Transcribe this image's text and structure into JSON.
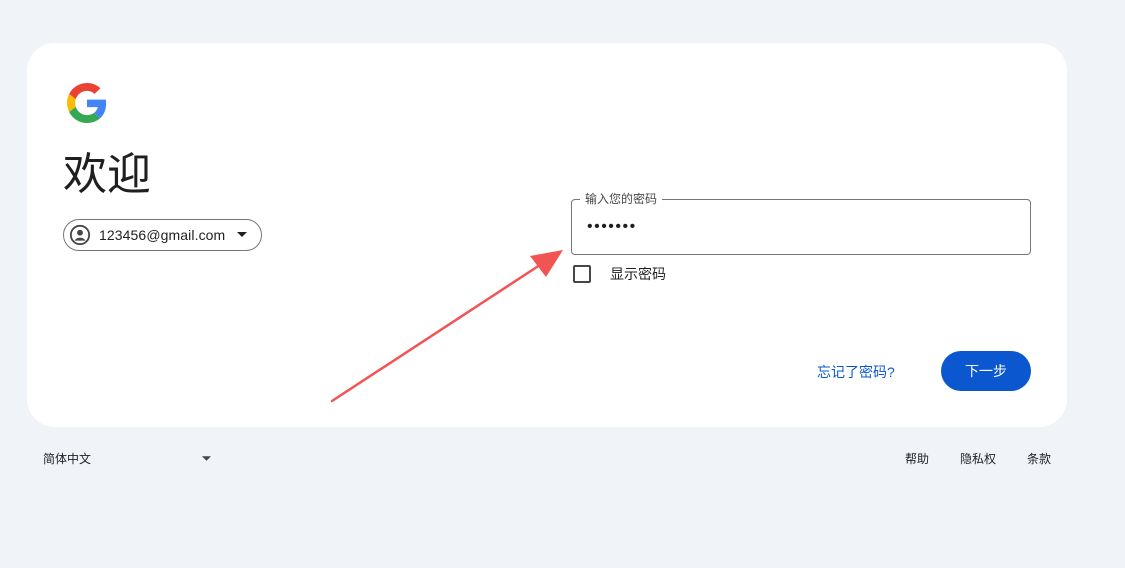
{
  "logo": {
    "icon": "google-g-logo-icon"
  },
  "heading": "欢迎",
  "account": {
    "email": "123456@gmail.com",
    "avatar_icon": "account-circle-icon",
    "caret_icon": "chevron-down-icon"
  },
  "password": {
    "label": "输入您的密码",
    "value": "•••••••"
  },
  "show_password": {
    "label": "显示密码",
    "checked": false
  },
  "actions": {
    "forgot_label": "忘记了密码?",
    "next_label": "下一步"
  },
  "footer": {
    "language": "简体中文",
    "links": [
      "帮助",
      "隐私权",
      "条款"
    ]
  },
  "annotation": {
    "type": "red-arrow",
    "color": "#f25454"
  },
  "colors": {
    "background": "#f0f4f9",
    "primary": "#0b57d0",
    "card": "#ffffff"
  }
}
